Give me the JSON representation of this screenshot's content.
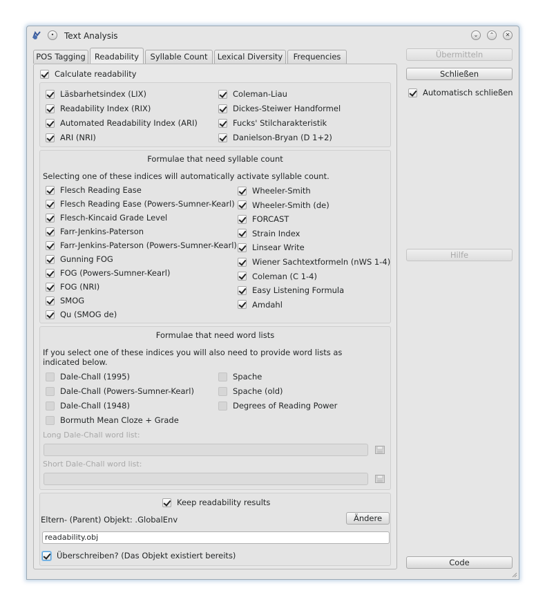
{
  "window": {
    "title": "Text Analysis"
  },
  "tabs": [
    "POS Tagging",
    "Readability",
    "Syllable Count",
    "Lexical Diversity",
    "Frequencies"
  ],
  "readability": {
    "calculate": {
      "label": "Calculate readability",
      "checked": true
    },
    "basic_indices": {
      "left": [
        {
          "label": "Läsbarhetsindex (LIX)",
          "checked": true
        },
        {
          "label": "Readability Index (RIX)",
          "checked": true
        },
        {
          "label": "Automated Readability Index (ARI)",
          "checked": true
        },
        {
          "label": "ARI (NRI)",
          "checked": true
        }
      ],
      "right": [
        {
          "label": "Coleman-Liau",
          "checked": true
        },
        {
          "label": "Dickes-Steiwer Handformel",
          "checked": true
        },
        {
          "label": "Fucks' Stilcharakteristik",
          "checked": true
        },
        {
          "label": "Danielson-Bryan (D 1+2)",
          "checked": true
        }
      ]
    },
    "syllable_group": {
      "title": "Formulae that need syllable count",
      "note": "Selecting one of these indices will automatically activate syllable count.",
      "left": [
        {
          "label": "Flesch Reading Ease",
          "checked": true
        },
        {
          "label": "Flesch Reading Ease (Powers-Sumner-Kearl)",
          "checked": true
        },
        {
          "label": "Flesch-Kincaid Grade Level",
          "checked": true
        },
        {
          "label": "Farr-Jenkins-Paterson",
          "checked": true
        },
        {
          "label": "Farr-Jenkins-Paterson (Powers-Sumner-Kearl)",
          "checked": true
        },
        {
          "label": "Gunning FOG",
          "checked": true
        },
        {
          "label": "FOG (Powers-Sumner-Kearl)",
          "checked": true
        },
        {
          "label": "FOG (NRI)",
          "checked": true
        },
        {
          "label": "SMOG",
          "checked": true
        },
        {
          "label": "Qu (SMOG de)",
          "checked": true
        }
      ],
      "right": [
        {
          "label": "Wheeler-Smith",
          "checked": true
        },
        {
          "label": "Wheeler-Smith (de)",
          "checked": true
        },
        {
          "label": "FORCAST",
          "checked": true
        },
        {
          "label": "Strain Index",
          "checked": true
        },
        {
          "label": "Linsear Write",
          "checked": true
        },
        {
          "label": "Wiener Sachtextformeln (nWS 1-4)",
          "checked": true
        },
        {
          "label": "Coleman (C 1-4)",
          "checked": true
        },
        {
          "label": "Easy Listening Formula",
          "checked": true
        },
        {
          "label": "Amdahl",
          "checked": true
        }
      ]
    },
    "wordlist_group": {
      "title": "Formulae that need word lists",
      "note": "If you select one of these indices you will also need to provide word lists as indicated below.",
      "left": [
        {
          "label": "Dale-Chall (1995)",
          "checked": false
        },
        {
          "label": "Dale-Chall (Powers-Sumner-Kearl)",
          "checked": false
        },
        {
          "label": "Dale-Chall (1948)",
          "checked": false
        },
        {
          "label": "Bormuth Mean Cloze + Grade",
          "checked": false
        }
      ],
      "right": [
        {
          "label": "Spache",
          "checked": false
        },
        {
          "label": "Spache (old)",
          "checked": false
        },
        {
          "label": "Degrees of Reading Power",
          "checked": false
        }
      ],
      "long_list_label": "Long Dale-Chall word list:",
      "long_list_value": "",
      "short_list_label": "Short Dale-Chall word list:",
      "short_list_value": ""
    },
    "keep": {
      "label": "Keep readability results",
      "checked": true,
      "parent_label": "Eltern- (Parent) Objekt: .GlobalEnv",
      "change_button": "Ändere",
      "object_name": "readability.obj",
      "overwrite_label": "Überschreiben? (Das Objekt existiert bereits)",
      "overwrite_checked": true
    }
  },
  "sidebar": {
    "submit": "Übermitteln",
    "close": "Schließen",
    "auto_close_label": "Automatisch schließen",
    "auto_close_checked": true,
    "help": "Hilfe",
    "code": "Code"
  },
  "colors": {
    "window_bg": "#e6e6e6",
    "focus_ring": "#5b9fd6"
  }
}
